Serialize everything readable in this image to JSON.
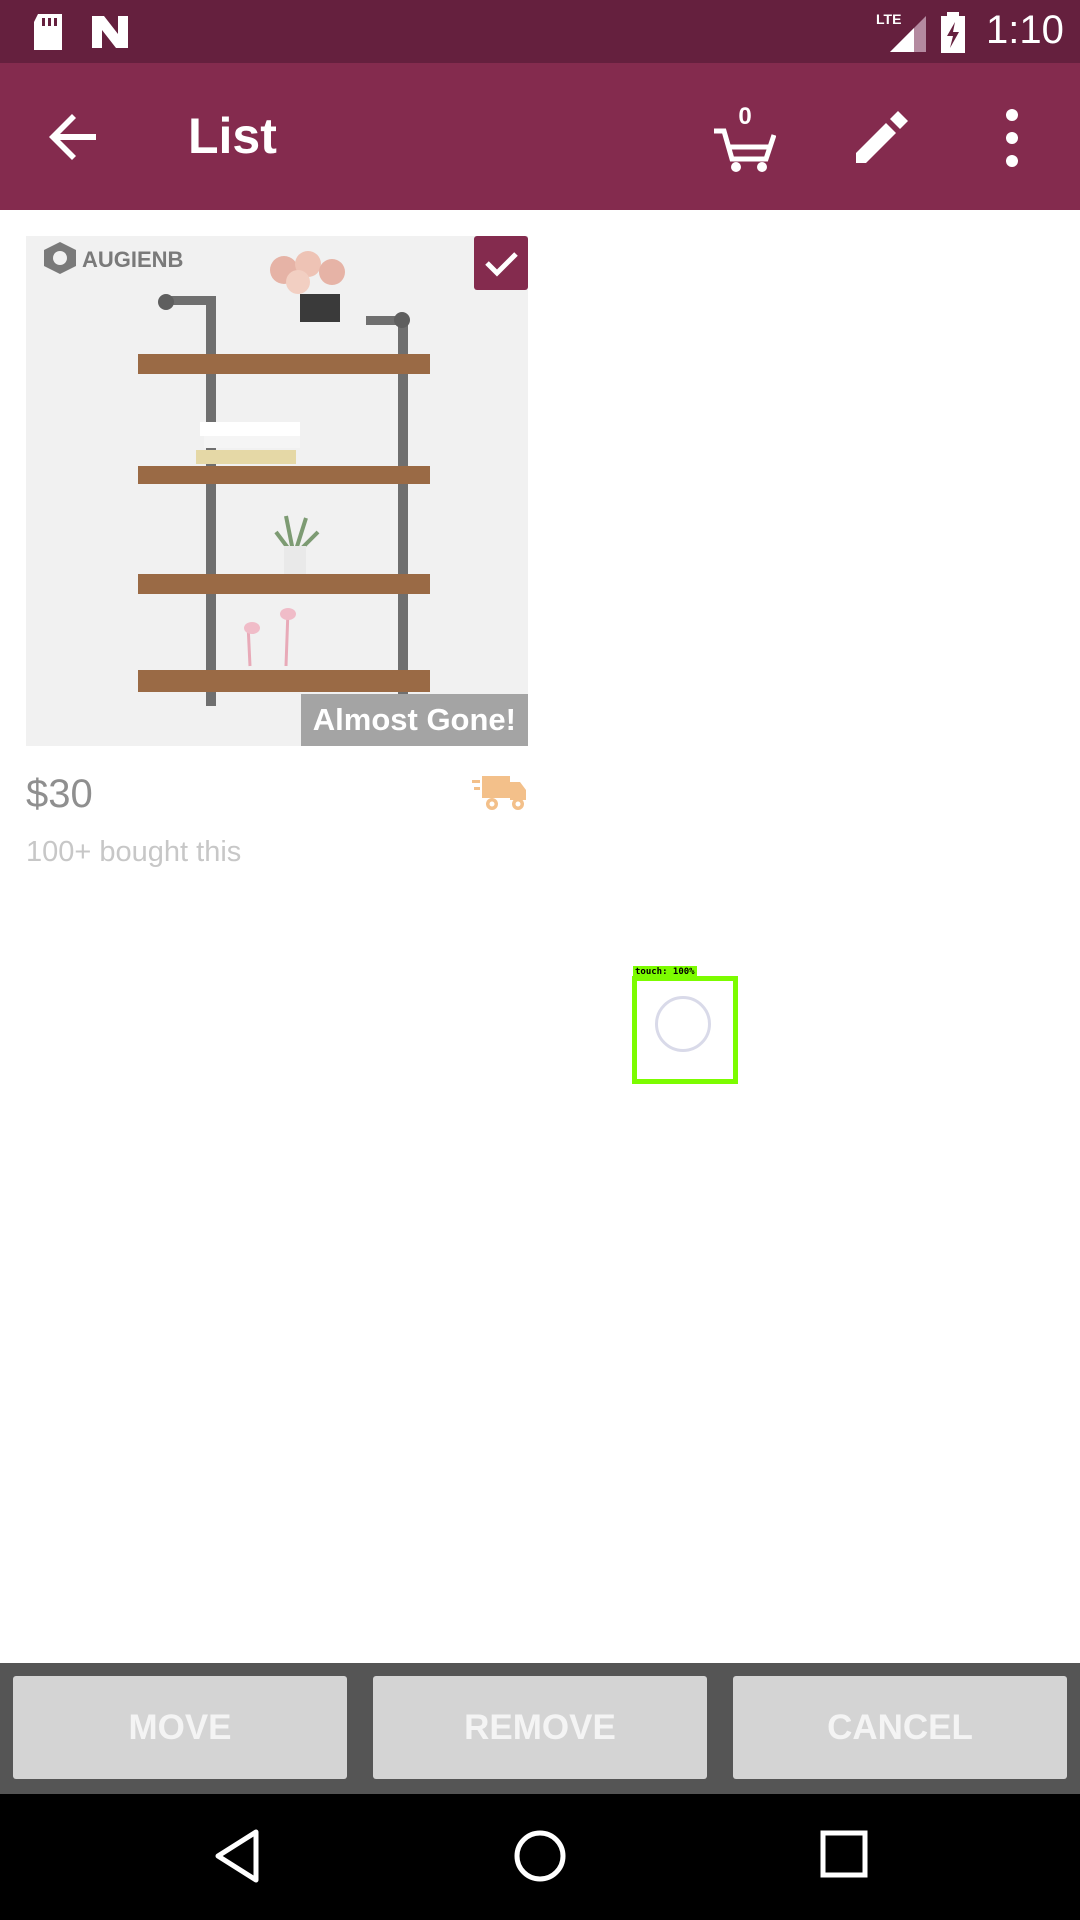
{
  "status_bar": {
    "time": "1:10",
    "icons": [
      "sd-card-icon",
      "n-notification-icon",
      "lte-signal-icon",
      "battery-charging-icon"
    ]
  },
  "app_bar": {
    "title": "List",
    "cart_count": "0",
    "icons": [
      "back-arrow-icon",
      "cart-icon",
      "edit-pencil-icon",
      "more-vert-icon"
    ]
  },
  "product": {
    "brand": "AUGIENB",
    "badge": "Almost Gone!",
    "price": "$30",
    "bought": "100+ bought this",
    "selected": true
  },
  "touch_overlay": {
    "label": "touch: 100%"
  },
  "actions": {
    "move": "MOVE",
    "remove": "REMOVE",
    "cancel": "CANCEL"
  },
  "colors": {
    "status_bar": "#65203e",
    "app_bar": "#842b4e",
    "touch_box": "#7cfc00"
  }
}
